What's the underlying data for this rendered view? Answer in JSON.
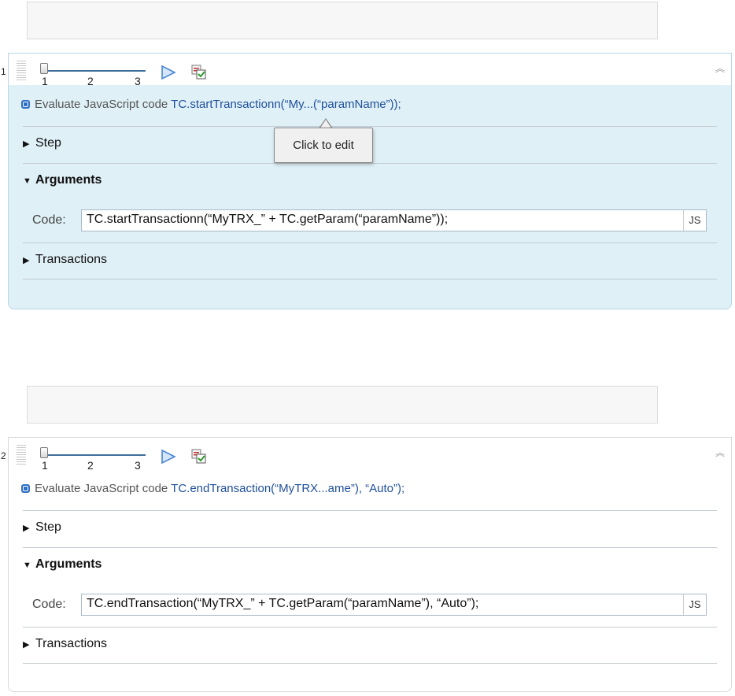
{
  "steps": [
    {
      "number": "1",
      "slider": {
        "labels": [
          "1",
          "2",
          "3"
        ],
        "value": "1"
      },
      "summary": {
        "prefix": "Evaluate JavaScript code ",
        "code": "TC.startTransactionn(“My...(“paramName”));"
      },
      "sections": {
        "step": "Step",
        "arguments": "Arguments",
        "transactions": "Transactions"
      },
      "code_label": "Code:",
      "code_value": "TC.startTransactionn(“MyTRX_” + TC.getParam(“paramName”));",
      "js_button": "JS"
    },
    {
      "number": "2",
      "slider": {
        "labels": [
          "1",
          "2",
          "3"
        ],
        "value": "1"
      },
      "summary": {
        "prefix": "Evaluate JavaScript code ",
        "code": "TC.endTransaction(“MyTRX...ame”), “Auto”);"
      },
      "sections": {
        "step": "Step",
        "arguments": "Arguments",
        "transactions": "Transactions"
      },
      "code_label": "Code:",
      "code_value": "TC.endTransaction(“MyTRX_” + TC.getParam(“paramName”), “Auto”);",
      "js_button": "JS"
    }
  ],
  "tooltip": "Click to edit",
  "icons": {
    "play": "play-icon",
    "validate": "validate-icon",
    "collapse": "double-chevron-up-icon",
    "js_badge": "javascript-step-icon"
  },
  "colors": {
    "selected_panel": "#dff0f7",
    "link": "#1f4f9a",
    "slider_track": "#3e6e99"
  }
}
